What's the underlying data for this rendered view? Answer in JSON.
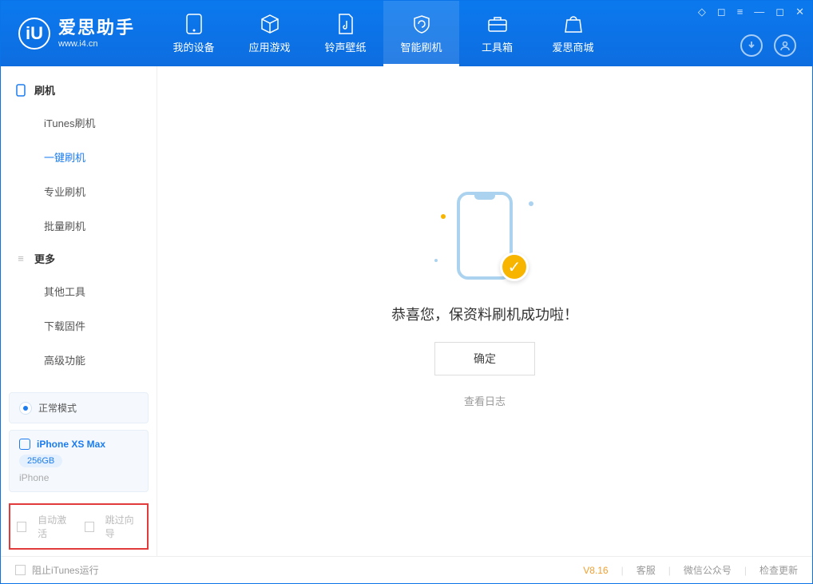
{
  "brand": {
    "cn": "爱思助手",
    "en": "www.i4.cn"
  },
  "tabs": [
    {
      "label": "我的设备"
    },
    {
      "label": "应用游戏"
    },
    {
      "label": "铃声壁纸"
    },
    {
      "label": "智能刷机"
    },
    {
      "label": "工具箱"
    },
    {
      "label": "爱思商城"
    }
  ],
  "sidebar": {
    "group1": "刷机",
    "items1": [
      {
        "label": "iTunes刷机"
      },
      {
        "label": "一键刷机"
      },
      {
        "label": "专业刷机"
      },
      {
        "label": "批量刷机"
      }
    ],
    "group2": "更多",
    "items2": [
      {
        "label": "其他工具"
      },
      {
        "label": "下载固件"
      },
      {
        "label": "高级功能"
      }
    ]
  },
  "device": {
    "mode": "正常模式",
    "name": "iPhone XS Max",
    "storage": "256GB",
    "type": "iPhone"
  },
  "options": {
    "auto_activate": "自动激活",
    "skip_guide": "跳过向导"
  },
  "main": {
    "message": "恭喜您，保资料刷机成功啦！",
    "ok": "确定",
    "log": "查看日志"
  },
  "footer": {
    "block_itunes": "阻止iTunes运行",
    "version": "V8.16",
    "support": "客服",
    "wechat": "微信公众号",
    "update": "检查更新"
  }
}
